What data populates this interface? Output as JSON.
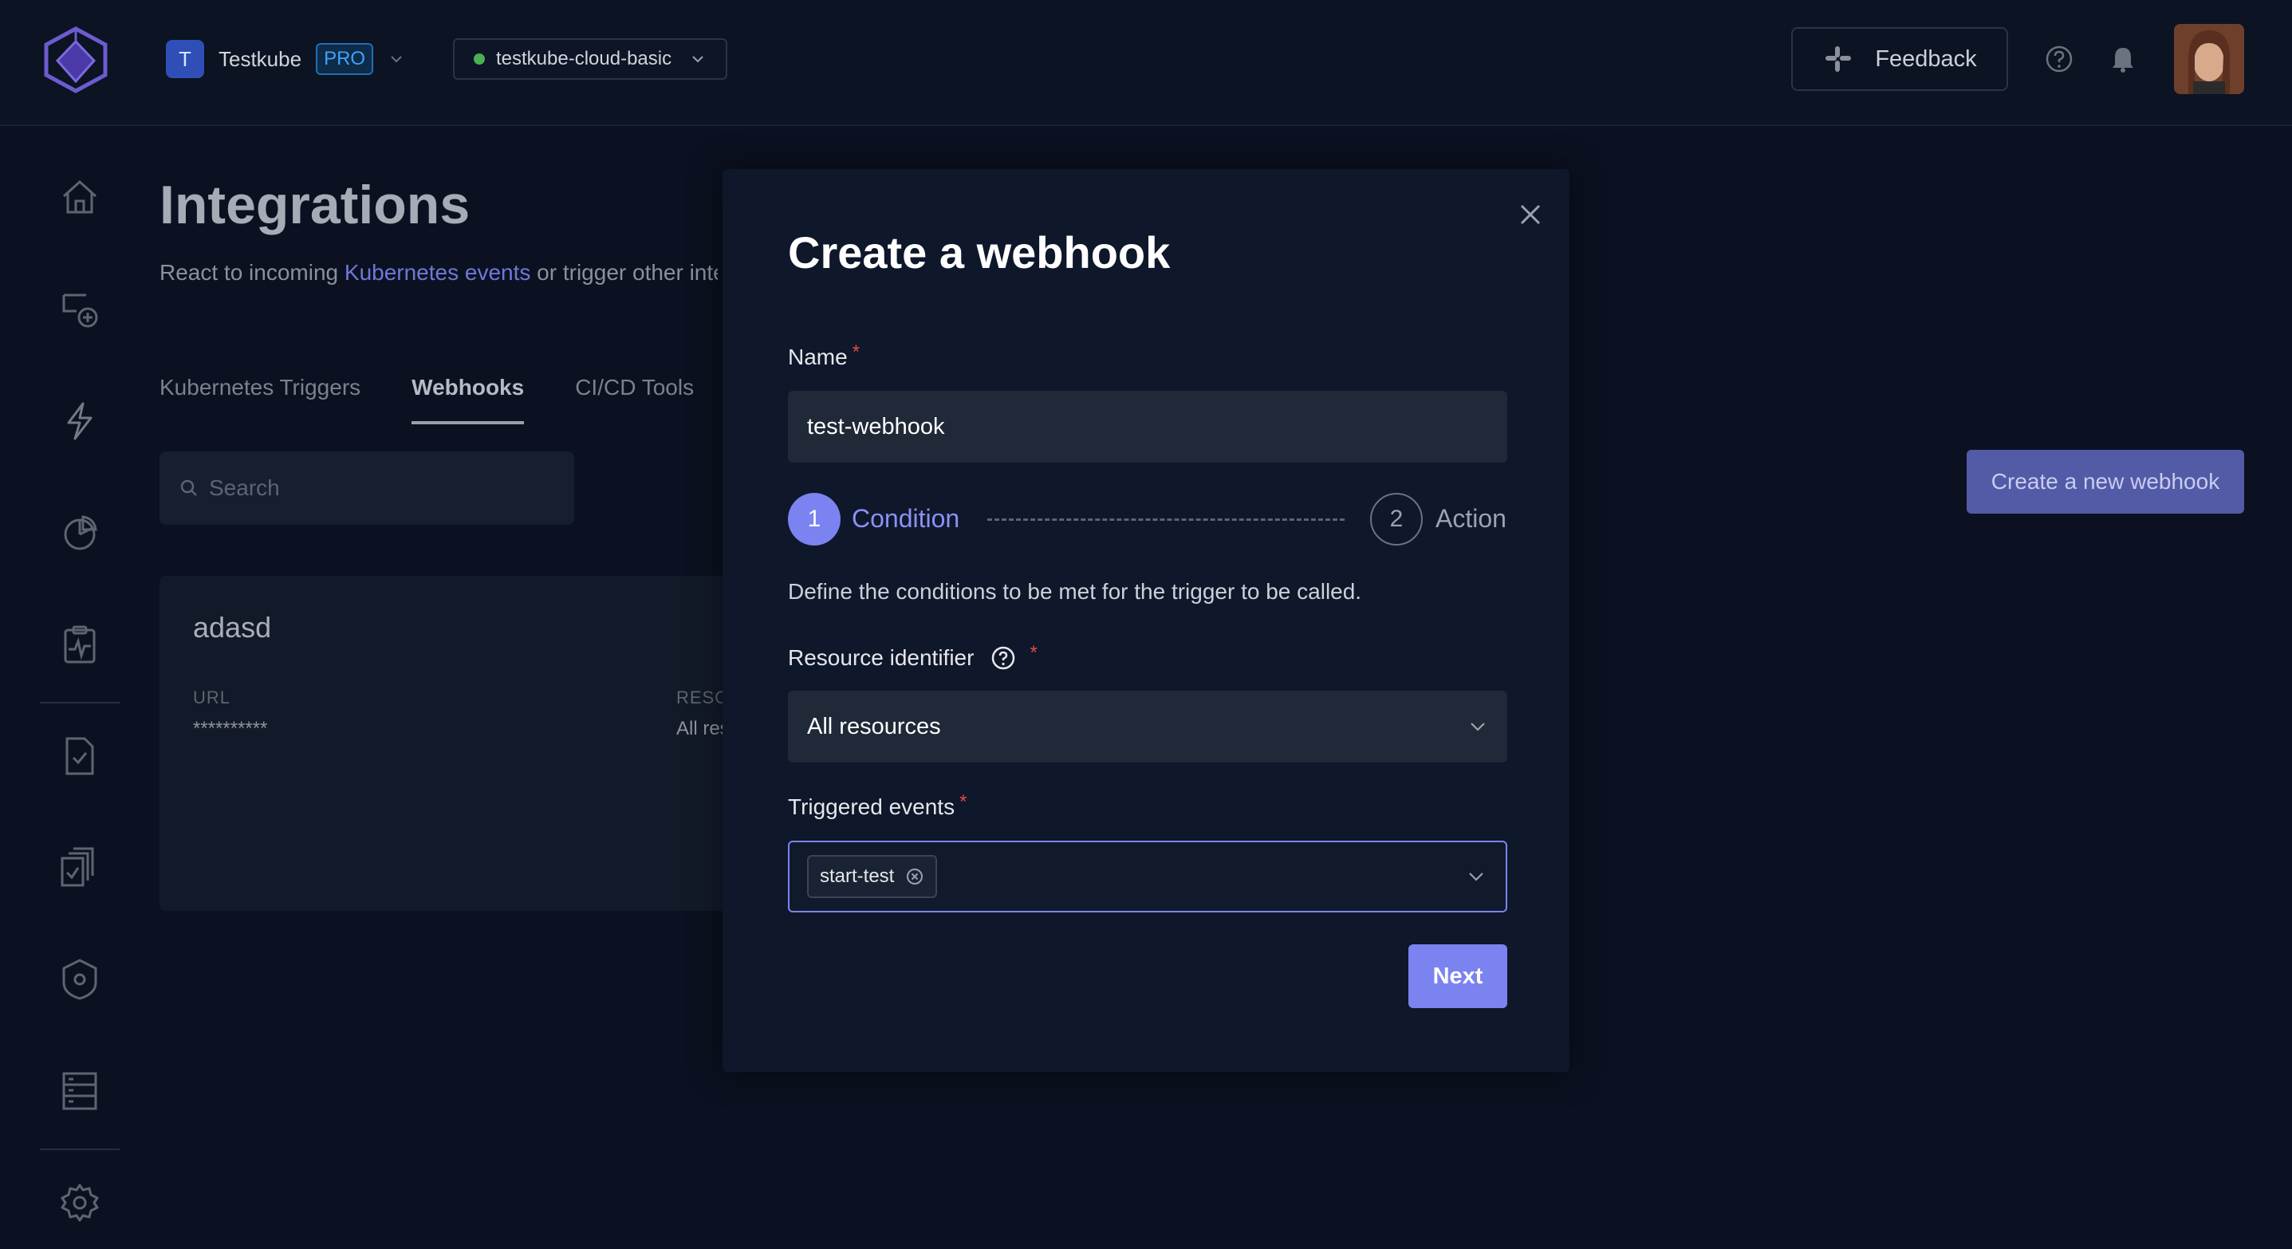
{
  "header": {
    "org_initial": "T",
    "org_name": "Testkube",
    "plan_badge": "PRO",
    "environment": "testkube-cloud-basic",
    "environment_status_color": "#4caf50",
    "feedback_label": "Feedback"
  },
  "sidebar": {
    "items": [
      "home-icon",
      "add-test-icon",
      "lightning-icon",
      "pie-chart-icon",
      "clipboard-pulse-icon",
      "file-check-icon",
      "test-suites-icon",
      "shield-gear-icon",
      "server-list-icon",
      "settings-icon"
    ]
  },
  "page": {
    "title": "Integrations",
    "desc_prefix": "React to incoming ",
    "desc_link": "Kubernetes events",
    "desc_suffix": " or trigger other inte",
    "tabs": [
      "Kubernetes Triggers",
      "Webhooks",
      "CI/CD Tools"
    ],
    "active_tab": "Webhooks",
    "search_placeholder": "Search",
    "card": {
      "title": "adasd",
      "url_label": "URL",
      "url_value": "**********",
      "resource_label": "RESO",
      "resource_value": "All res"
    },
    "create_button": "Create a new webhook"
  },
  "modal": {
    "title": "Create a webhook",
    "name_label": "Name",
    "name_value": "test-webhook",
    "steps": [
      {
        "number": "1",
        "label": "Condition",
        "active": true
      },
      {
        "number": "2",
        "label": "Action",
        "active": false
      }
    ],
    "step_description": "Define the conditions to be met for the trigger to be called.",
    "resource_label": "Resource identifier",
    "resource_value": "All resources",
    "events_label": "Triggered events",
    "events_tags": [
      "start-test"
    ],
    "next_button": "Next"
  },
  "colors": {
    "accent": "#7b83f0",
    "required": "#e04a4a",
    "background": "#0b1120",
    "modal_bg": "#0f172a"
  }
}
